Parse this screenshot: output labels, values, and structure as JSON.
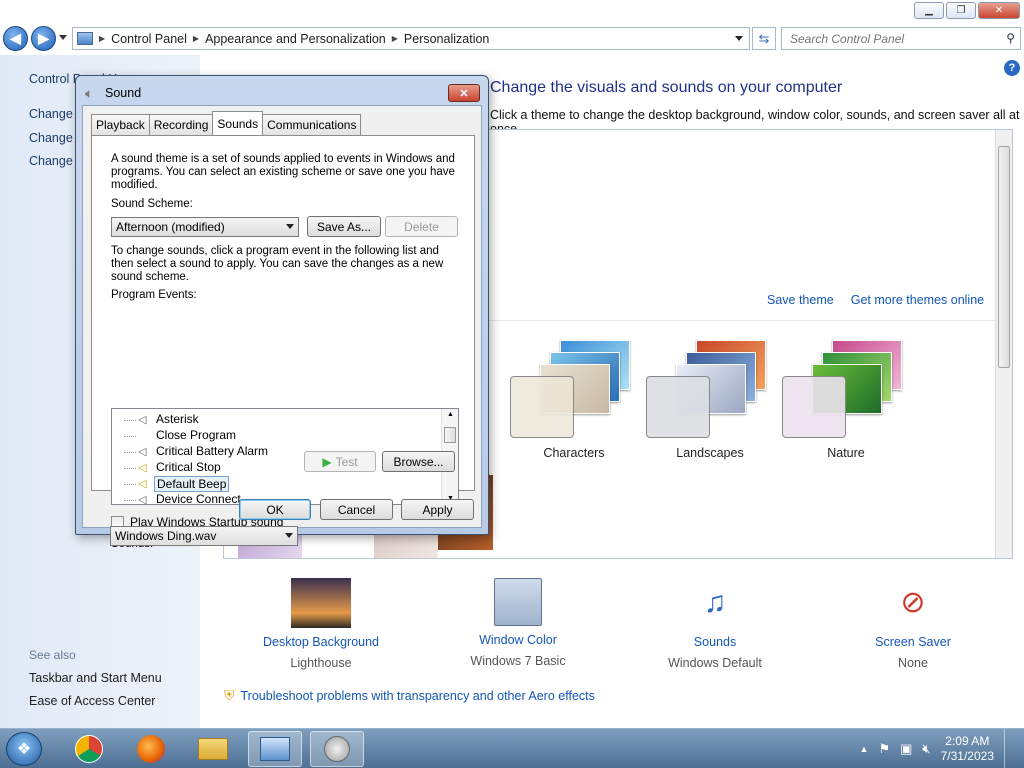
{
  "window_controls": {
    "minimize": "▁",
    "maximize": "❐",
    "close": "✕"
  },
  "nav": {
    "back": "◀",
    "forward": "▶",
    "breadcrumbs": [
      "Control Panel",
      "Appearance and Personalization",
      "Personalization"
    ],
    "search_placeholder": "Search Control Panel"
  },
  "left_pane": {
    "control_panel_home": "Control Panel Home",
    "links": [
      "Change desktop icons",
      "Change mouse pointers",
      "Change your account picture"
    ],
    "see_also_label": "See also",
    "see_also": [
      "Taskbar and Start Menu",
      "Ease of Access Center"
    ]
  },
  "main": {
    "heading": "Change the visuals and sounds on your computer",
    "subtext": "Click a theme to change the desktop background, window color, sounds, and screen saver all at once.",
    "save_theme": "Save theme",
    "get_more_themes": "Get more themes online",
    "themes": [
      {
        "name": "Characters"
      },
      {
        "name": "Landscapes"
      },
      {
        "name": "Nature"
      }
    ],
    "bottom": [
      {
        "label": "Desktop Background",
        "value": "Lighthouse"
      },
      {
        "label": "Window Color",
        "value": "Windows 7 Basic"
      },
      {
        "label": "Sounds",
        "value": "Windows Default"
      },
      {
        "label": "Screen Saver",
        "value": "None"
      }
    ],
    "troubleshoot": "Troubleshoot problems with transparency and other Aero effects"
  },
  "dialog": {
    "title": "Sound",
    "close": "✕",
    "tabs": [
      "Playback",
      "Recording",
      "Sounds",
      "Communications"
    ],
    "active_tab": "Sounds",
    "intro": "A sound theme is a set of sounds applied to events in Windows and programs.  You can select an existing scheme or save one you have modified.",
    "scheme_label": "Sound Scheme:",
    "scheme_value": "Afternoon (modified)",
    "save_as": "Save As...",
    "delete": "Delete",
    "change_text": "To change sounds, click a program event in the following list and then select a sound to apply.  You can save the changes as a new sound scheme.",
    "events_label": "Program Events:",
    "events": [
      {
        "name": "Asterisk",
        "has_sound": true
      },
      {
        "name": "Close Program",
        "has_sound": false
      },
      {
        "name": "Critical Battery Alarm",
        "has_sound": true
      },
      {
        "name": "Critical Stop",
        "has_sound": true
      },
      {
        "name": "Default Beep",
        "has_sound": true,
        "selected": true
      },
      {
        "name": "Device Connect",
        "has_sound": true
      }
    ],
    "startup_label": "Play Windows Startup sound",
    "startup_checked": false,
    "sounds_label": "Sounds:",
    "sound_value": "Windows Ding.wav",
    "test": "Test",
    "browse": "Browse...",
    "ok": "OK",
    "cancel": "Cancel",
    "apply": "Apply"
  },
  "taskbar": {
    "time": "2:09 AM",
    "date": "7/31/2023"
  }
}
